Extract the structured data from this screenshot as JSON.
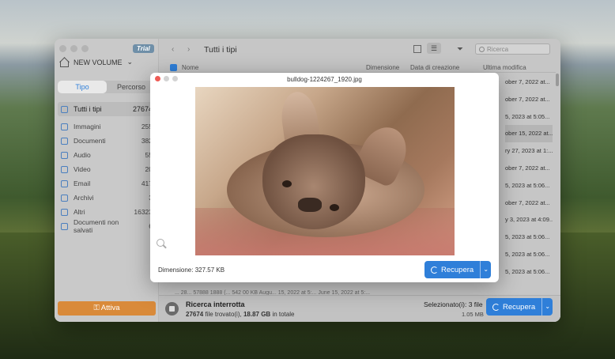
{
  "sidebar": {
    "trial_badge": "Trial",
    "volume": "NEW VOLUME",
    "tabs": [
      "Tipo",
      "Percorso"
    ],
    "categories": [
      {
        "label": "Tutti i tipi",
        "count": "27674",
        "selected": true
      },
      {
        "label": "Immagini",
        "count": "255"
      },
      {
        "label": "Documenti",
        "count": "382"
      },
      {
        "label": "Audio",
        "count": "55"
      },
      {
        "label": "Video",
        "count": "20"
      },
      {
        "label": "Email",
        "count": "417"
      },
      {
        "label": "Archivi",
        "count": "3"
      },
      {
        "label": "Altri",
        "count": "16323"
      },
      {
        "label": "Documenti non salvati",
        "count": "6"
      }
    ],
    "activate_button": "Attiva"
  },
  "toolbar": {
    "title": "Tutti i tipi",
    "search_placeholder": "Ricerca"
  },
  "table": {
    "headers": [
      "Nome",
      "Dimensione",
      "Data di creazione",
      "Ultima modifica"
    ],
    "modified_column": [
      "ober 7, 2022 at...",
      "ober 7, 2022 at...",
      "5, 2023 at 5:05...",
      "ober 15, 2022 at...",
      "ry 27, 2023 at 1:...",
      "ober 7, 2022 at...",
      "5, 2023 at 5:06...",
      "ober 7, 2022 at...",
      "y 3, 2023 at 4:09...",
      "5, 2023 at 5:06...",
      "5, 2023 at 5:06...",
      "5, 2023 at 5:06..."
    ],
    "last_row_partial": "... 28... 57888 1888 (...     542 00 KB     Augu... 15, 2022 at 5:...   June 15, 2022 at 5:..."
  },
  "status": {
    "title": "Ricerca interrotta",
    "found_count": "27674",
    "found_text": "file trovato(i),",
    "total_size": "18.87 GB",
    "total_text": "in totale",
    "selected": "Selezionato(i): 3 file",
    "selected_size": "1.05 MB",
    "recover_button": "Recupera"
  },
  "preview": {
    "filename": "bulldog-1224267_1920.jpg",
    "size_label": "Dimensione: 327.57 KB",
    "recover_button": "Recupera"
  },
  "colors": {
    "accent": "#2f7fd9",
    "activate": "#d98a3a"
  }
}
